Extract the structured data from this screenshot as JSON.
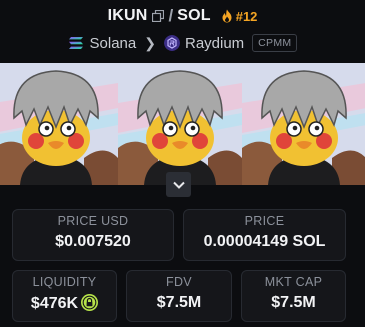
{
  "header": {
    "base_symbol": "IKUN",
    "separator": "/",
    "quote_symbol": "SOL",
    "rank": "#12"
  },
  "route": {
    "chain": "Solana",
    "dex": "Raydium",
    "pool_type": "CPMM"
  },
  "stats": {
    "price_usd_label": "PRICE USD",
    "price_usd": "$0.007520",
    "price_label": "PRICE",
    "price": "0.00004149 SOL",
    "liquidity_label": "LIQUIDITY",
    "liquidity": "$476K",
    "fdv_label": "FDV",
    "fdv": "$7.5M",
    "mktcap_label": "MKT CAP",
    "mktcap": "$7.5M"
  },
  "icons": {
    "copy": "copy-icon",
    "rank": "fire-icon",
    "chain": "solana-icon",
    "dex": "raydium-icon",
    "expand": "chevron-down-icon",
    "liquidity_lock": "lock-icon"
  },
  "colors": {
    "background": "#0c0d10",
    "card": "#15161a",
    "rank_accent": "#f5a524",
    "lock_badge": "#b7e34a"
  }
}
